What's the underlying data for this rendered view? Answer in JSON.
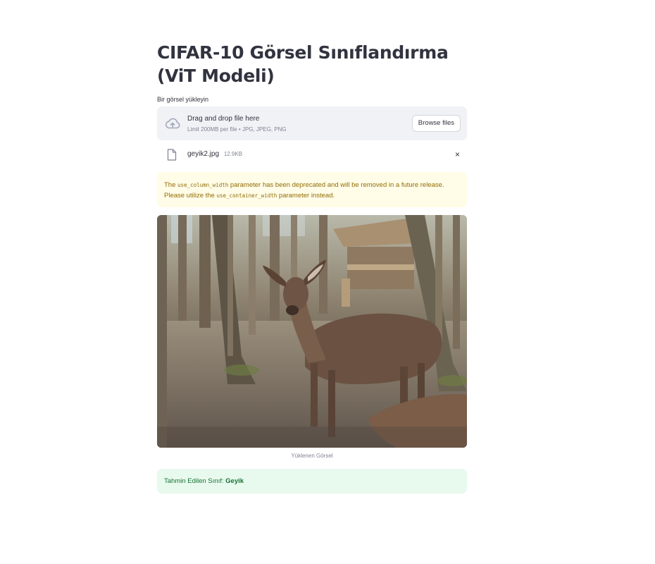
{
  "page": {
    "title": "CIFAR-10 Görsel Sınıflandırma (ViT Modeli)"
  },
  "uploader": {
    "label": "Bir görsel yükleyin",
    "drop_text": "Drag and drop file here",
    "limit_text": "Limit 200MB per file • JPG, JPEG, PNG",
    "browse_label": "Browse files",
    "file_name": "geyik2.jpg",
    "file_size": "12.9KB",
    "remove_icon": "×"
  },
  "warning": {
    "text_1": "The ",
    "code_1": "use_column_width",
    "text_2": " parameter has been deprecated and will be removed in a future release. Please utilize the ",
    "code_2": "use_container_width",
    "text_3": " parameter instead."
  },
  "image": {
    "caption": "Yüklenen Görsel",
    "subject": "deer-in-forest"
  },
  "result": {
    "label": "Tahmin Edilen Sınıf: ",
    "value": "Geyik"
  },
  "colors": {
    "warning_bg": "#fffce7",
    "warning_text": "#926c05",
    "success_bg": "#e8f9ee",
    "success_text": "#177233",
    "dropzone_bg": "#f0f2f6"
  }
}
